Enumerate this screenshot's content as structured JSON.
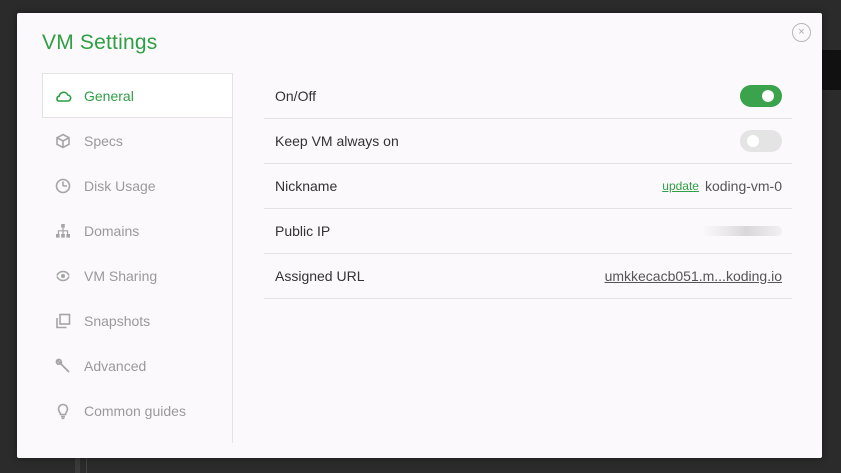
{
  "dialog": {
    "title": "VM Settings",
    "close_glyph": "×"
  },
  "sidebar": {
    "items": [
      {
        "label": "General",
        "icon": "cloud-icon",
        "active": true
      },
      {
        "label": "Specs",
        "icon": "cube-icon",
        "active": false
      },
      {
        "label": "Disk Usage",
        "icon": "gauge-icon",
        "active": false
      },
      {
        "label": "Domains",
        "icon": "sitemap-icon",
        "active": false
      },
      {
        "label": "VM Sharing",
        "icon": "share-icon",
        "active": false
      },
      {
        "label": "Snapshots",
        "icon": "copy-icon",
        "active": false
      },
      {
        "label": "Advanced",
        "icon": "wrench-icon",
        "active": false
      },
      {
        "label": "Common guides",
        "icon": "lightbulb-icon",
        "active": false
      }
    ]
  },
  "general": {
    "on_off": {
      "label": "On/Off",
      "enabled": true
    },
    "keep_on": {
      "label": "Keep VM always on",
      "enabled": false
    },
    "nickname": {
      "label": "Nickname",
      "update_label": "update",
      "value": "koding-vm-0"
    },
    "public_ip": {
      "label": "Public IP",
      "value_obscured": true
    },
    "assigned_url": {
      "label": "Assigned URL",
      "value": "umkkecacb051.m...koding.io"
    }
  },
  "colors": {
    "accent": "#2f9e44",
    "toggle_on": "#3aa34b",
    "toggle_off": "#e4e4e4",
    "text": "#333333",
    "muted": "#9a9a9a"
  }
}
